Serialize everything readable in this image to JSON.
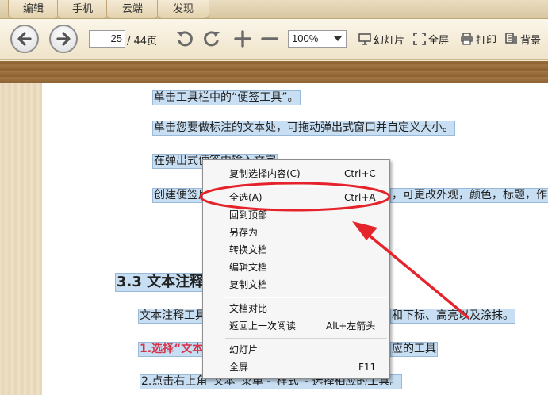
{
  "tabs": [
    {
      "label": "编辑"
    },
    {
      "label": "手机"
    },
    {
      "label": "云端"
    },
    {
      "label": "发现"
    }
  ],
  "toolbar": {
    "current_page": "25",
    "total_pages": "/ 44页",
    "zoom": "100%",
    "slideshow_label": "幻灯片",
    "fullscreen_label": "全屏",
    "print_label": "打印",
    "background_label": "背景"
  },
  "document": {
    "line1": "单击工具栏中的“便签工具”。",
    "line2": "单击您要做标注的文本处，可拖动弹出式窗口并自定义大小。",
    "line3": "在弹出式便签中输入文字",
    "line4_start": "创建便签后",
    "line4_end": "，可更改外观，颜色，标题，作",
    "heading": "3.3 文本注释工",
    "line5_start": "文本注释工具",
    "line5_end": "和下标、高亮以及涂抹。",
    "line6_red": "1.选择“文本",
    "line6_end": "应的工具",
    "line7": "2.点击右上角“文本”菜单 -“样式”- 选择相应的工具。"
  },
  "context_menu": {
    "items": [
      {
        "label": "复制选择内容(C)",
        "shortcut": "Ctrl+C"
      },
      {
        "label": "全选(A)",
        "shortcut": "Ctrl+A"
      },
      {
        "label": "回到顶部",
        "shortcut": ""
      },
      {
        "label": "另存为",
        "shortcut": ""
      },
      {
        "label": "转换文档",
        "shortcut": ""
      },
      {
        "label": "编辑文档",
        "shortcut": ""
      },
      {
        "label": "复制文档",
        "shortcut": ""
      },
      {
        "label": "文档对比",
        "shortcut": ""
      },
      {
        "label": "返回上一次阅读",
        "shortcut": "Alt+左箭头"
      },
      {
        "label": "幻灯片",
        "shortcut": ""
      },
      {
        "label": "全屏",
        "shortcut": "F11"
      }
    ]
  },
  "annotation": {
    "color": "#e5232b",
    "highlighted_item": "全选(A)"
  }
}
